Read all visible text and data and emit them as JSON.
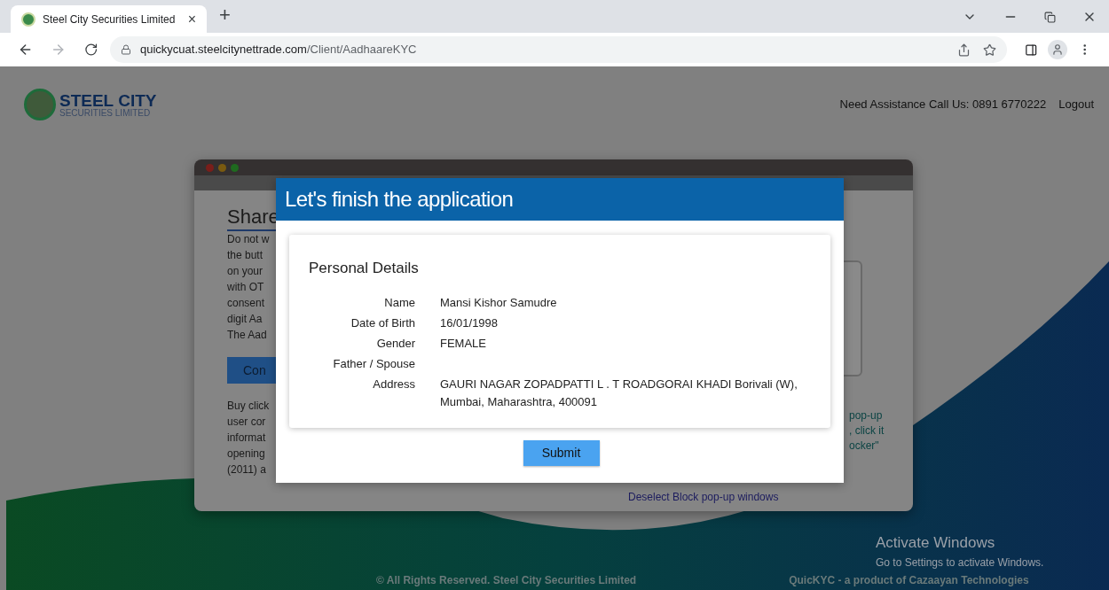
{
  "browser": {
    "tab": {
      "title": "Steel City Securities Limited",
      "close": "×"
    },
    "new_tab": "+",
    "url_host": "quickycuat.steelcitynettrade.com",
    "url_path": "/Client/AadhaareKYC"
  },
  "header": {
    "logo_title": "STEEL CITY",
    "logo_subtitle": "SECURITIES LIMITED",
    "assistance": "Need Assistance Call Us: 0891 6770222",
    "logout": "Logout"
  },
  "background_card": {
    "heading": "Share",
    "lines_1": [
      "Do not w",
      "the butt",
      "on your",
      "with OT",
      "consent",
      "digit Aa",
      "The Aad"
    ],
    "button": "Con",
    "lines_2": [
      "Buy click",
      "user cor",
      "informat",
      "opening",
      "(2011) a"
    ],
    "right_lines": [
      "pop-up",
      ", click it",
      "ocker\""
    ],
    "link": "Deselect Block pop-up windows"
  },
  "modal": {
    "title": "Let's finish the application",
    "section": "Personal Details",
    "fields": [
      {
        "label": "Name",
        "value": "Mansi Kishor Samudre"
      },
      {
        "label": "Date of Birth",
        "value": "16/01/1998"
      },
      {
        "label": "Gender",
        "value": "FEMALE"
      },
      {
        "label": "Father / Spouse"
      },
      {
        "label": "Address",
        "value": "GAURI NAGAR ZOPADPATTI L . T ROADGORAI KHADI Borivali (W), Mumbai, Maharashtra, 400091"
      }
    ],
    "submit": "Submit"
  },
  "footer": {
    "copyright": "© All Rights Reserved. Steel City Securities Limited",
    "product": "QuicKYC - a product of Cazaayan Technologies"
  },
  "os_notice": {
    "title": "Activate Windows",
    "text": "Go to Settings to activate Windows."
  }
}
